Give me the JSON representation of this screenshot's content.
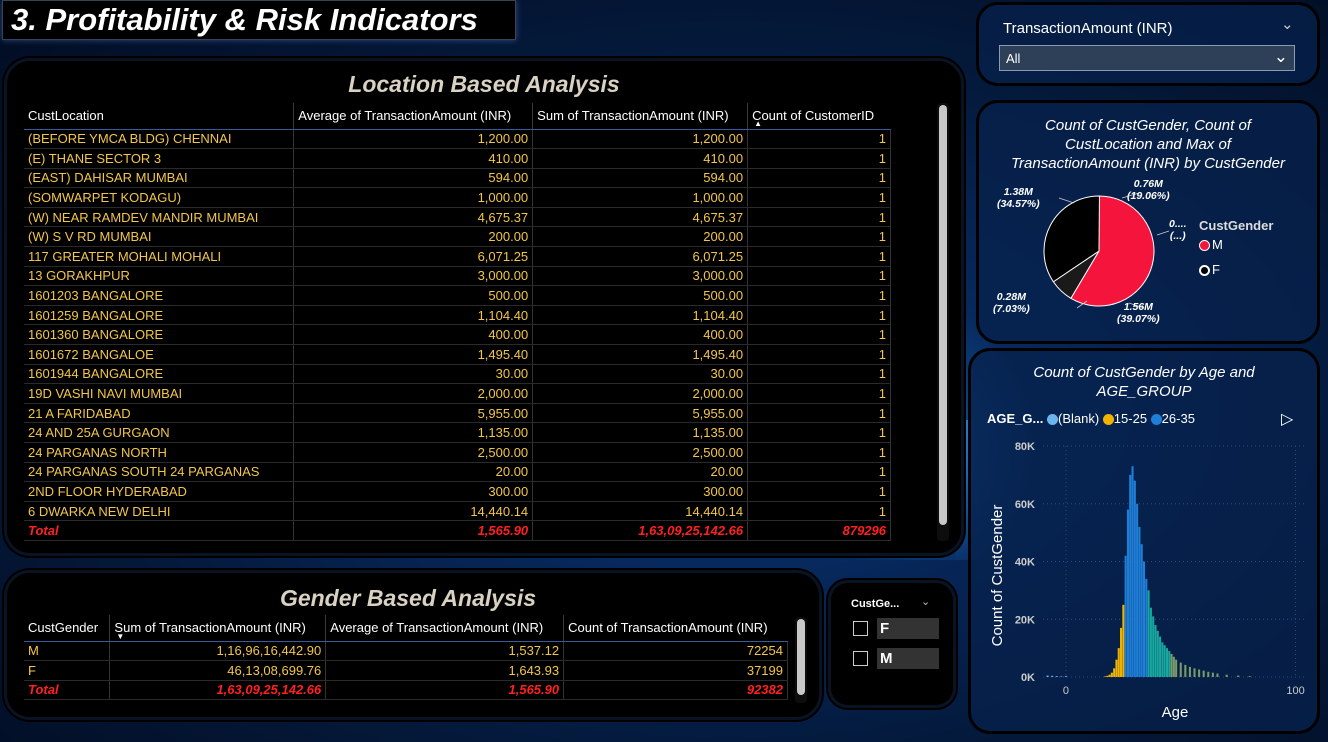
{
  "page_title": "3. Profitability & Risk Indicators",
  "location_table": {
    "title": "Location Based Analysis",
    "columns": [
      "CustLocation",
      "Average of TransactionAmount (INR)",
      "Sum of TransactionAmount (INR)",
      "Count of CustomerID"
    ],
    "rows": [
      [
        "(BEFORE YMCA BLDG) CHENNAI",
        "1,200.00",
        "1,200.00",
        "1"
      ],
      [
        "(E) THANE SECTOR 3",
        "410.00",
        "410.00",
        "1"
      ],
      [
        "(EAST) DAHISAR MUMBAI",
        "594.00",
        "594.00",
        "1"
      ],
      [
        "(SOMWARPET KODAGU)",
        "1,000.00",
        "1,000.00",
        "1"
      ],
      [
        "(W) NEAR RAMDEV MANDIR MUMBAI",
        "4,675.37",
        "4,675.37",
        "1"
      ],
      [
        "(W) S V RD MUMBAI",
        "200.00",
        "200.00",
        "1"
      ],
      [
        "117 GREATER MOHALI MOHALI",
        "6,071.25",
        "6,071.25",
        "1"
      ],
      [
        "13 GORAKHPUR",
        "3,000.00",
        "3,000.00",
        "1"
      ],
      [
        "1601203 BANGALORE",
        "500.00",
        "500.00",
        "1"
      ],
      [
        "1601259 BANGALORE",
        "1,104.40",
        "1,104.40",
        "1"
      ],
      [
        "1601360 BANGALORE",
        "400.00",
        "400.00",
        "1"
      ],
      [
        "1601672 BANGALOE",
        "1,495.40",
        "1,495.40",
        "1"
      ],
      [
        "1601944 BANGALORE",
        "30.00",
        "30.00",
        "1"
      ],
      [
        "19D VASHI NAVI MUMBAI",
        "2,000.00",
        "2,000.00",
        "1"
      ],
      [
        "21 A FARIDABAD",
        "5,955.00",
        "5,955.00",
        "1"
      ],
      [
        "24 AND 25A GURGAON",
        "1,135.00",
        "1,135.00",
        "1"
      ],
      [
        "24 PARGANAS NORTH",
        "2,500.00",
        "2,500.00",
        "1"
      ],
      [
        "24 PARGANAS SOUTH 24 PARGANAS",
        "20.00",
        "20.00",
        "1"
      ],
      [
        "2ND FLOOR HYDERABAD",
        "300.00",
        "300.00",
        "1"
      ],
      [
        "6 DWARKA NEW DELHI",
        "14,440.14",
        "14,440.14",
        "1"
      ]
    ],
    "total": [
      "Total",
      "1,565.90",
      "1,63,09,25,142.66",
      "879296"
    ]
  },
  "gender_table": {
    "title": "Gender Based Analysis",
    "columns": [
      "CustGender",
      "Sum of TransactionAmount (INR)",
      "Average of TransactionAmount (INR)",
      "Count of TransactionAmount (INR)"
    ],
    "rows": [
      [
        "M",
        "1,16,96,16,442.90",
        "1,537.12",
        "72254"
      ],
      [
        "F",
        "46,13,08,699.76",
        "1,643.93",
        "37199"
      ]
    ],
    "total": [
      "Total",
      "1,63,09,25,142.66",
      "1,565.90",
      "92382"
    ]
  },
  "gender_slicer": {
    "header": "CustGe...",
    "options": [
      "F",
      "M"
    ]
  },
  "amount_slicer": {
    "label": "TransactionAmount (INR)",
    "selected": "All"
  },
  "pie_chart": {
    "title": "Count of CustGender, Count of CustLocation and Max of TransactionAmount (INR) by CustGender",
    "legend_title": "CustGender",
    "legend": [
      "M",
      "F"
    ],
    "labels": [
      {
        "value": "0.76M",
        "pct": "(19.06%)"
      },
      {
        "value": "0....",
        "pct": "(...)"
      },
      {
        "value": "1.56M",
        "pct": "(39.07%)"
      },
      {
        "value": "0.28M",
        "pct": "(7.03%)"
      },
      {
        "value": "1.38M",
        "pct": "(34.57%)"
      }
    ],
    "colors": {
      "M": "#f5143c",
      "F": "#000000"
    }
  },
  "chart_data": {
    "type": "bar",
    "title": "Count of CustGender by Age and AGE_GROUP",
    "xlabel": "Age",
    "ylabel": "Count of CustGender",
    "xlim": [
      -10,
      105
    ],
    "ylim": [
      0,
      80000
    ],
    "x_ticks": [
      "0",
      "100"
    ],
    "y_ticks": [
      "0K",
      "20K",
      "40K",
      "60K",
      "80K"
    ],
    "legend_title": "AGE_G...",
    "legend": [
      "(Blank)",
      "15-25",
      "26-35"
    ],
    "series": [
      {
        "name": "(Blank)",
        "color": "#6cb4f0",
        "x": [
          -8,
          -6,
          -4,
          -2,
          0
        ],
        "values": [
          500,
          400,
          300,
          200,
          300
        ]
      },
      {
        "name": "15-25",
        "color": "#f0b400",
        "x": [
          17,
          18,
          19,
          20,
          21,
          22,
          23,
          24,
          25
        ],
        "values": [
          200,
          400,
          800,
          1500,
          3000,
          6000,
          10000,
          17000,
          25000
        ]
      },
      {
        "name": "26-35",
        "color": "#1f7fd8",
        "x": [
          26,
          27,
          28,
          29,
          30,
          31,
          32,
          33,
          34,
          35
        ],
        "values": [
          42000,
          58000,
          70000,
          73000,
          68000,
          60000,
          52000,
          46000,
          40000,
          34000
        ]
      },
      {
        "name": "",
        "color": "#18a8a0",
        "x": [
          36,
          37,
          38,
          39,
          40,
          41,
          42,
          43,
          44,
          45
        ],
        "values": [
          30000,
          24000,
          21000,
          18000,
          16000,
          14000,
          12000,
          11000,
          10000,
          9000
        ]
      },
      {
        "name": "",
        "color": "#7a9a6a",
        "x": [
          46,
          47,
          48,
          50,
          52,
          54,
          56,
          58,
          60,
          62,
          64,
          66,
          70,
          75,
          80
        ],
        "values": [
          8000,
          7000,
          6000,
          5000,
          4200,
          3500,
          3000,
          2600,
          2200,
          1800,
          1500,
          1200,
          800,
          500,
          300
        ]
      }
    ]
  }
}
